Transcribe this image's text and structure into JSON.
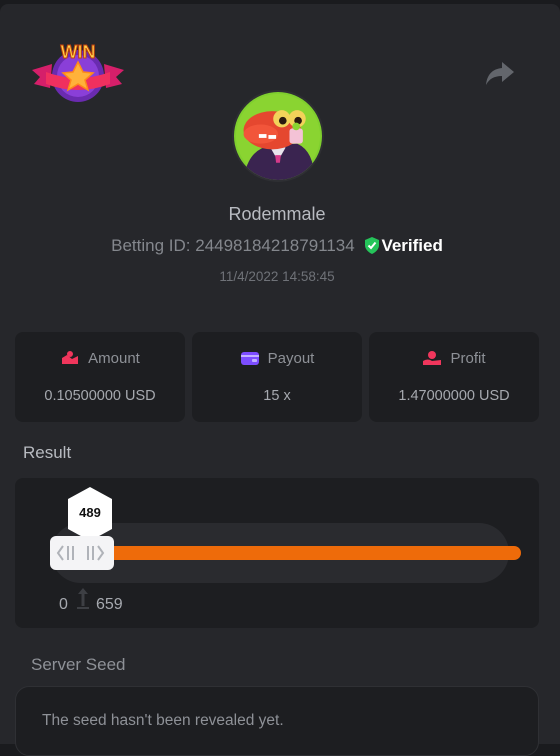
{
  "header": {
    "badge_text": "WIN",
    "username": "Rodemmale",
    "betting_id_label": "Betting ID:",
    "betting_id": "24498184218791134",
    "verified_label": "Verified",
    "timestamp": "11/4/2022 14:58:45"
  },
  "stats": [
    {
      "label": "Amount",
      "value": "0.10500000 USD",
      "icon": "amount-icon",
      "color": "#f0365c"
    },
    {
      "label": "Payout",
      "value": "15 x",
      "icon": "wallet-icon",
      "color": "#7c4dff"
    },
    {
      "label": "Profit",
      "value": "1.47000000 USD",
      "icon": "profit-icon",
      "color": "#f0365c"
    }
  ],
  "result": {
    "label": "Result",
    "roll_value": "489",
    "min": "0",
    "max": "659",
    "bar_color": "#ee6b0a"
  },
  "seed": {
    "label": "Server Seed",
    "text": "The seed hasn't been revealed yet."
  },
  "colors": {
    "verified": "#25c45a",
    "accent": "#ee6b0a"
  }
}
